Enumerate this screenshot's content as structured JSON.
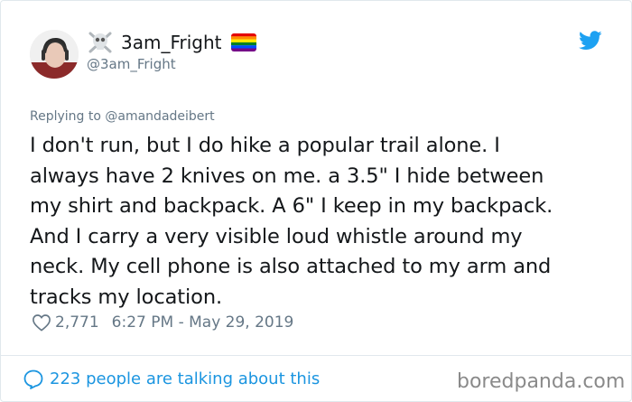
{
  "user": {
    "display_name": "3am_Fright",
    "handle": "@3am_Fright",
    "name_emoji_left": "skull-crossbones-icon",
    "name_emoji_right": "rainbow-flag-icon"
  },
  "reply": {
    "prefix": "Replying to ",
    "mention": "@amandadeibert"
  },
  "tweet": {
    "lines": [
      "I don't run, but I do hike a popular trail alone. I",
      "always have 2 knives on me. a 3.5\" I hide between",
      "my shirt and backpack. A 6\" I keep in my backpack.",
      "And I carry a very visible loud whistle around my",
      "neck. My cell phone is also attached to my arm and",
      "tracks my location."
    ]
  },
  "meta": {
    "likes": "2,771",
    "timestamp": "6:27 PM - May 29, 2019"
  },
  "footer": {
    "talk_label": "223 people are talking about this",
    "watermark": "boredpanda.com"
  },
  "colors": {
    "link_blue": "#1b95e0",
    "twitter_blue": "#1da1f2",
    "muted_gray": "#657786",
    "text": "#14171a"
  }
}
